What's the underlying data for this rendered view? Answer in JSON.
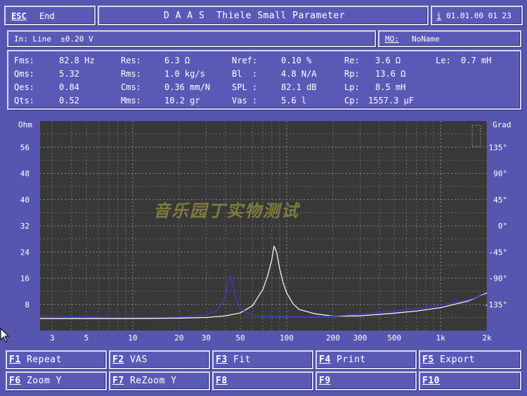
{
  "header": {
    "esc_key": "ESC",
    "esc_label": "End",
    "title": "D A A S  Thiele Small Parameter",
    "info_key": "i",
    "datetime": "01.01.00 01 23"
  },
  "input": {
    "label": "In: Line  ±0.20 V",
    "mic_key": "MO:",
    "mic_name": "NoName"
  },
  "params": {
    "col1": [
      {
        "name": "Fms:",
        "value": "82.8 Hz"
      },
      {
        "name": "Qms:",
        "value": "5.32"
      },
      {
        "name": "Qes:",
        "value": "0.84"
      },
      {
        "name": "Qts:",
        "value": "0.52"
      }
    ],
    "col2": [
      {
        "name": "Res:",
        "value": "6.3 Ω"
      },
      {
        "name": "Rms:",
        "value": "1.0 kg/s"
      },
      {
        "name": "Cms:",
        "value": "0.36 mm/N"
      },
      {
        "name": "Mms:",
        "value": "10.2 gr"
      }
    ],
    "col3": [
      {
        "name": "Nref:",
        "value": "0.10 %"
      },
      {
        "name": "Bl  :",
        "value": "4.8 N/A"
      },
      {
        "name": "SPL :",
        "value": "82.1 dB"
      },
      {
        "name": "Vas :",
        "value": "5.6 l"
      }
    ],
    "col4": [
      {
        "name": "Re:",
        "value": "3.6 Ω"
      },
      {
        "name": "Rp:",
        "value": "13.6 Ω"
      },
      {
        "name": "Lp:",
        "value": "8.5 mH"
      },
      {
        "name": "Cp:",
        "value": "1557.3 µF"
      }
    ],
    "col5": [
      {
        "name": "Le:",
        "value": "0.7 mH"
      }
    ]
  },
  "chart_data": {
    "type": "line",
    "left_axis_unit": "Ohm",
    "right_axis_unit": "Grad",
    "x_scale": "log",
    "xlim": [
      2.5,
      2000
    ],
    "ylim_left": [
      0,
      64
    ],
    "ylim_right": [
      -180,
      180
    ],
    "x_ticks": [
      "3",
      "5",
      "10",
      "20",
      "30",
      "50",
      "100",
      "200",
      "300",
      "500",
      "1k",
      "2k"
    ],
    "left_ticks": [
      "56",
      "48",
      "40",
      "32",
      "24",
      "16",
      "8"
    ],
    "right_ticks": [
      "135°",
      "90°",
      "45°",
      "0°",
      "-45°",
      "-90°",
      "-135°"
    ],
    "grid": true,
    "watermark": "音乐园丁实物测试",
    "series": [
      {
        "color": "#f2f2f2",
        "x": [
          2.5,
          5,
          10,
          20,
          30,
          40,
          50,
          60,
          70,
          75,
          80,
          82.8,
          86,
          90,
          95,
          100,
          110,
          120,
          150,
          200,
          300,
          500,
          700,
          1000,
          1500,
          2000
        ],
        "y": [
          3.7,
          3.7,
          3.7,
          3.8,
          4.0,
          4.5,
          5.4,
          7.6,
          12.5,
          16.5,
          21.5,
          25.8,
          24.0,
          19.0,
          14.5,
          11.5,
          8.2,
          6.5,
          5.2,
          4.4,
          4.5,
          5.3,
          6.0,
          7.0,
          9.0,
          11.5
        ]
      },
      {
        "color": "#3a3ad8",
        "x": [
          2.5,
          5,
          10,
          20,
          30,
          35,
          38,
          40,
          41.5,
          43,
          45,
          47,
          50,
          55,
          60,
          70,
          100,
          150,
          200,
          300,
          500,
          700,
          1000,
          1500,
          2000
        ],
        "y": [
          4.6,
          4.2,
          4.0,
          4.1,
          4.8,
          6.0,
          8.2,
          11.0,
          14.5,
          16.8,
          13.5,
          9.5,
          6.8,
          5.4,
          4.7,
          4.4,
          4.2,
          4.2,
          4.4,
          5.0,
          6.0,
          6.8,
          7.8,
          9.3,
          11.2
        ]
      }
    ]
  },
  "fkeys": [
    {
      "key": "F1",
      "label": "Repeat"
    },
    {
      "key": "F2",
      "label": "VAS"
    },
    {
      "key": "F3",
      "label": "Fit"
    },
    {
      "key": "F4",
      "label": "Print"
    },
    {
      "key": "F5",
      "label": "Export"
    },
    {
      "key": "F6",
      "label": "Zoom Y"
    },
    {
      "key": "F7",
      "label": "ReZoom Y"
    },
    {
      "key": "F8",
      "label": ""
    },
    {
      "key": "F9",
      "label": ""
    },
    {
      "key": "F10",
      "label": ""
    }
  ]
}
